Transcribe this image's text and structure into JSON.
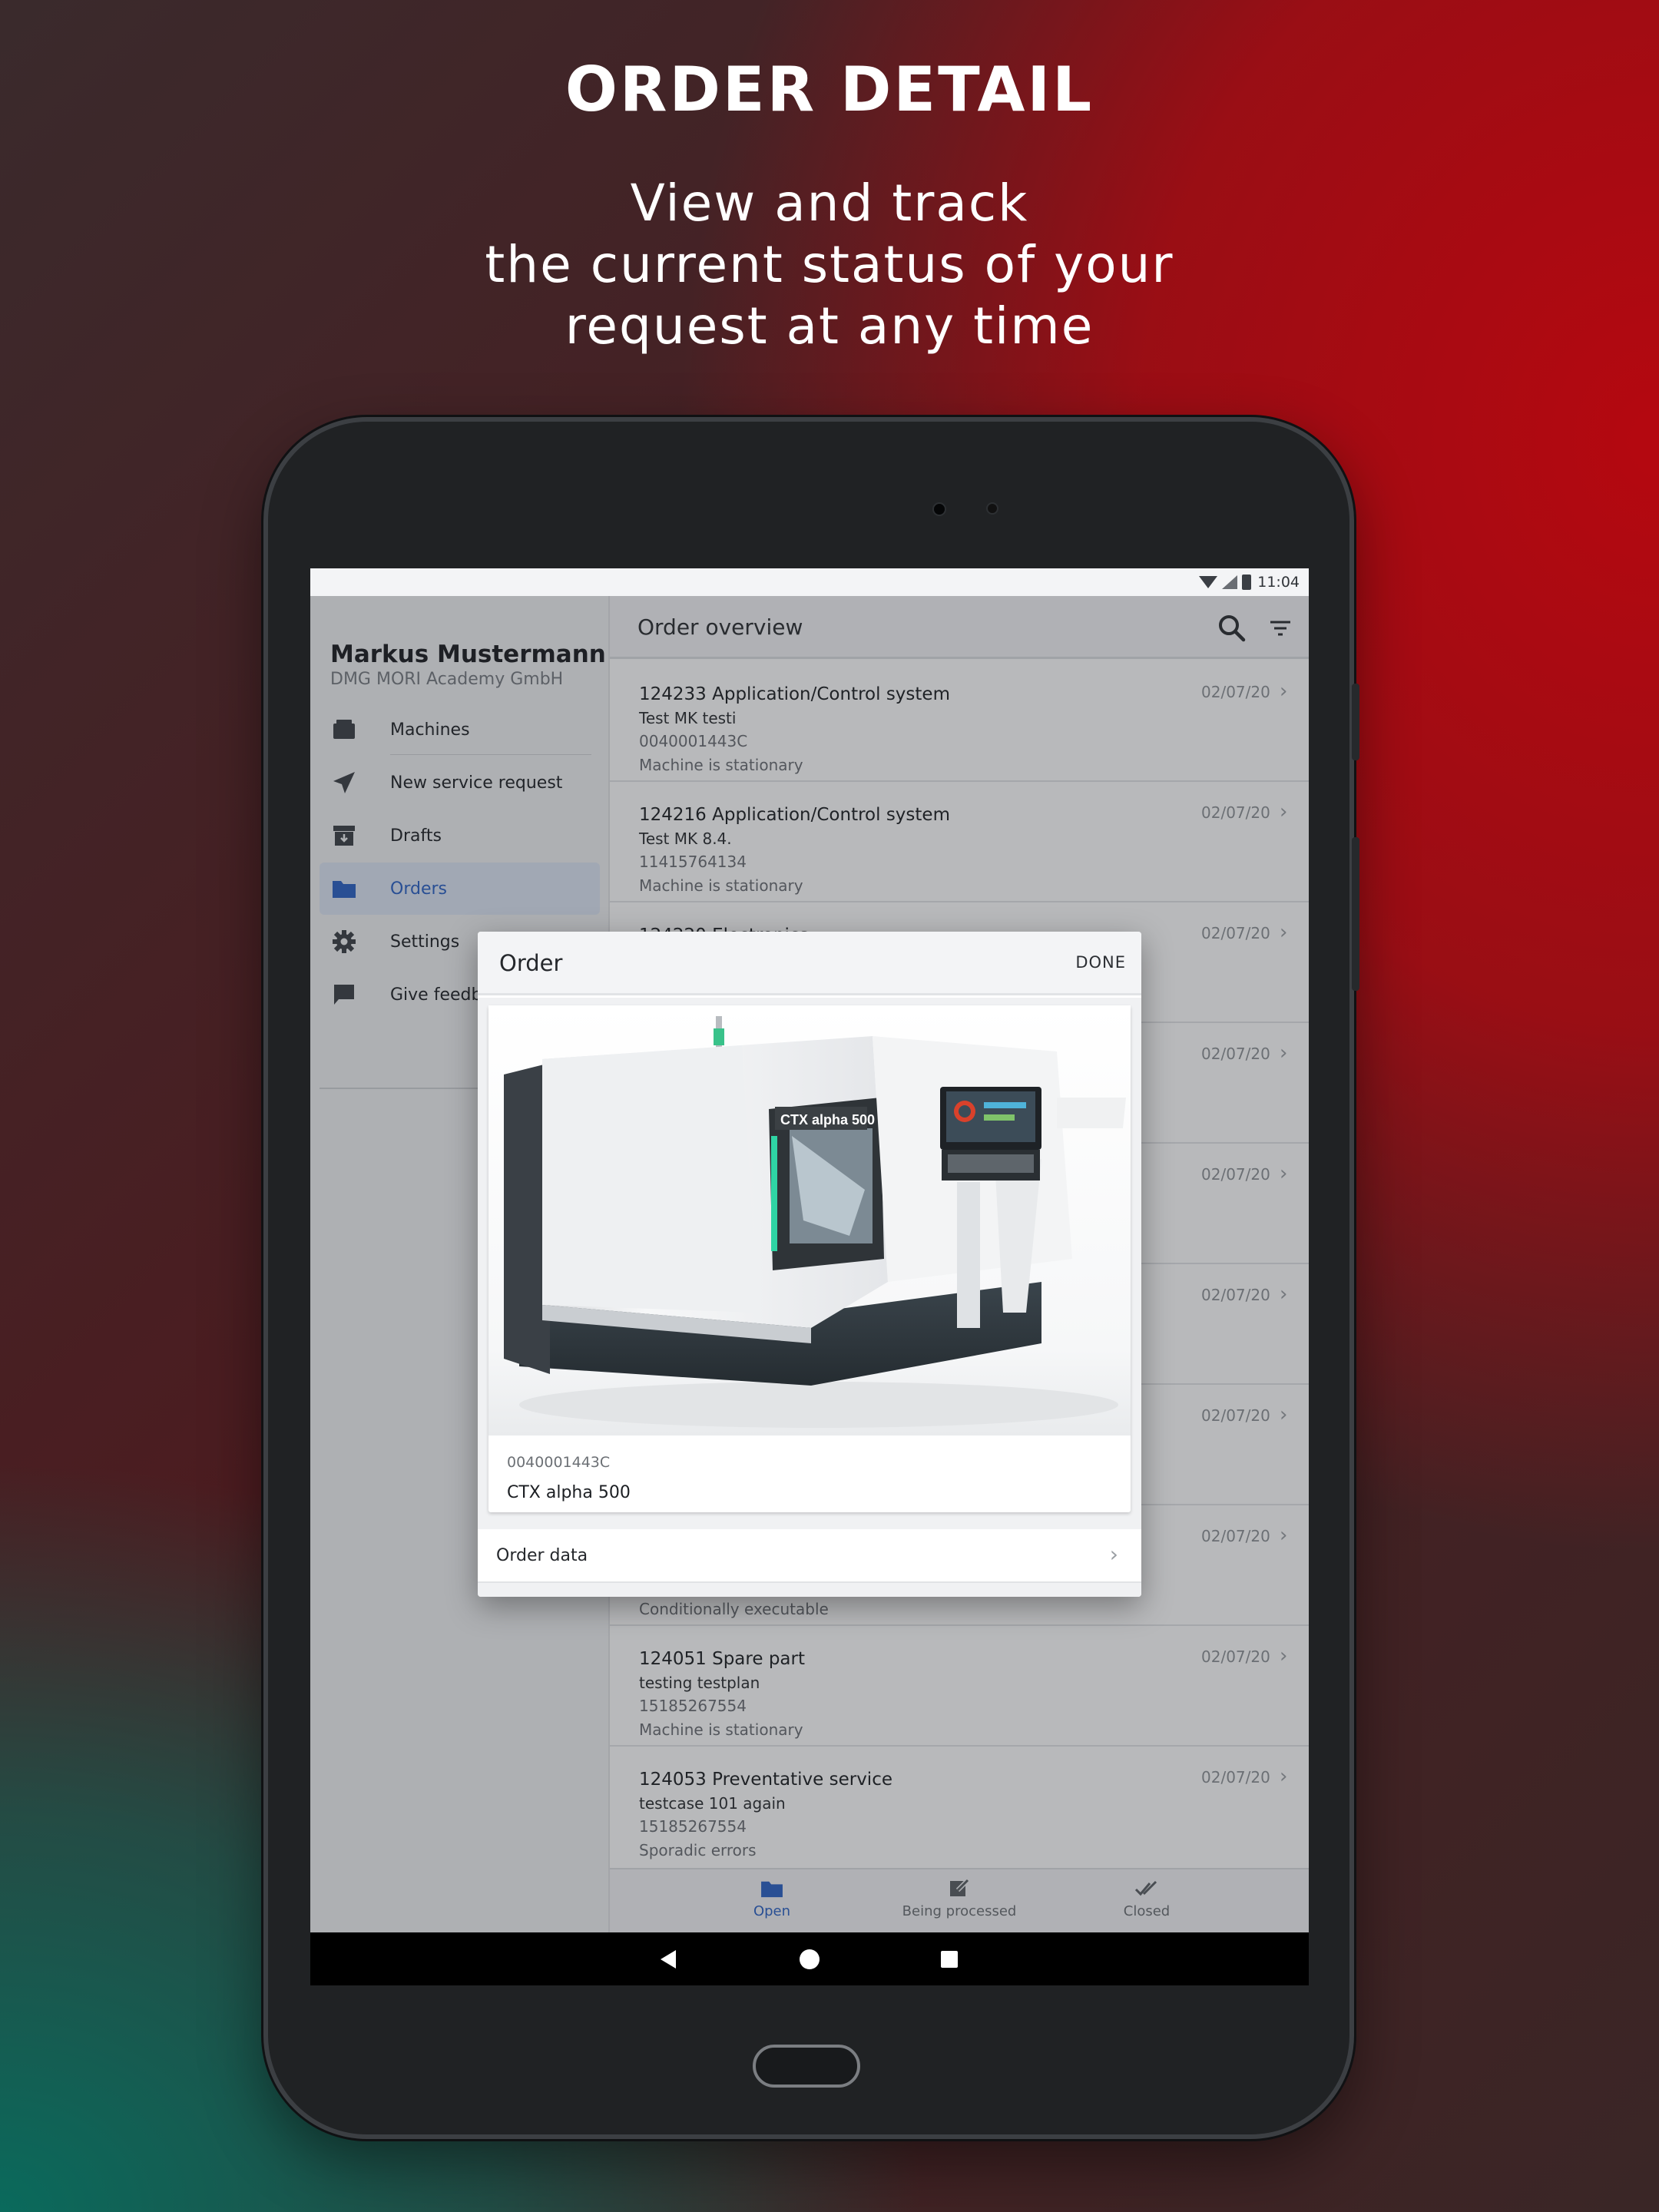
{
  "promo": {
    "title": "ORDER DETAIL",
    "subtitle_lines": [
      "View and track",
      "the current status of your",
      "request at any time"
    ]
  },
  "status_bar": {
    "time": "11:04"
  },
  "drawer": {
    "user_name": "Markus Mustermann",
    "user_org": "DMG MORI Academy GmbH",
    "items": [
      {
        "label": "Machines",
        "icon": "machine-icon"
      },
      {
        "label": "New service request",
        "icon": "send-icon"
      },
      {
        "label": "Drafts",
        "icon": "archive-icon"
      },
      {
        "label": "Orders",
        "icon": "folder-icon",
        "active": true
      },
      {
        "label": "Settings",
        "icon": "gear-icon"
      },
      {
        "label": "Give feedback",
        "icon": "chat-icon"
      }
    ]
  },
  "toolbar": {
    "title": "Order overview"
  },
  "orders": [
    {
      "title": "124233 Application/Control system",
      "subtitle": "Test MK testi",
      "number": "0040001443C",
      "status": "Machine is stationary",
      "date": "02/07/20"
    },
    {
      "title": "124216 Application/Control system",
      "subtitle": "Test MK 8.4.",
      "number": "11415764134",
      "status": "Machine is stationary",
      "date": "02/07/20"
    },
    {
      "title": "124220 Electronics",
      "subtitle": "",
      "number": "",
      "status": "",
      "date": "02/07/20"
    },
    {
      "title": "",
      "subtitle": "",
      "number": "",
      "status": "",
      "date": "02/07/20"
    },
    {
      "title": "",
      "subtitle": "",
      "number": "",
      "status": "",
      "date": "02/07/20"
    },
    {
      "title": "",
      "subtitle": "",
      "number": "",
      "status": "",
      "date": "02/07/20"
    },
    {
      "title": "",
      "subtitle": "",
      "number": "",
      "status": "",
      "date": "02/07/20"
    },
    {
      "title": "",
      "subtitle": "",
      "number": "",
      "status": "Conditionally executable",
      "date": "02/07/20"
    },
    {
      "title": "124051 Spare part",
      "subtitle": "testing testplan",
      "number": "15185267554",
      "status": "Machine is stationary",
      "date": "02/07/20"
    },
    {
      "title": "124053 Preventative service",
      "subtitle": "testcase 101 again",
      "number": "15185267554",
      "status": "Sporadic errors",
      "date": "02/07/20"
    }
  ],
  "bottom_nav": {
    "open_label": "Open",
    "processing_label": "Being processed",
    "closed_label": "Closed"
  },
  "dialog": {
    "title": "Order",
    "done_label": "DONE",
    "machine_number": "0040001443C",
    "machine_name": "CTX alpha 500",
    "machine_badge": "CTX alpha 500",
    "order_data_label": "Order data"
  },
  "colors": {
    "accent": "#2b62c5",
    "brand_red": "#b50810",
    "brand_teal": "#0a6a5c"
  }
}
